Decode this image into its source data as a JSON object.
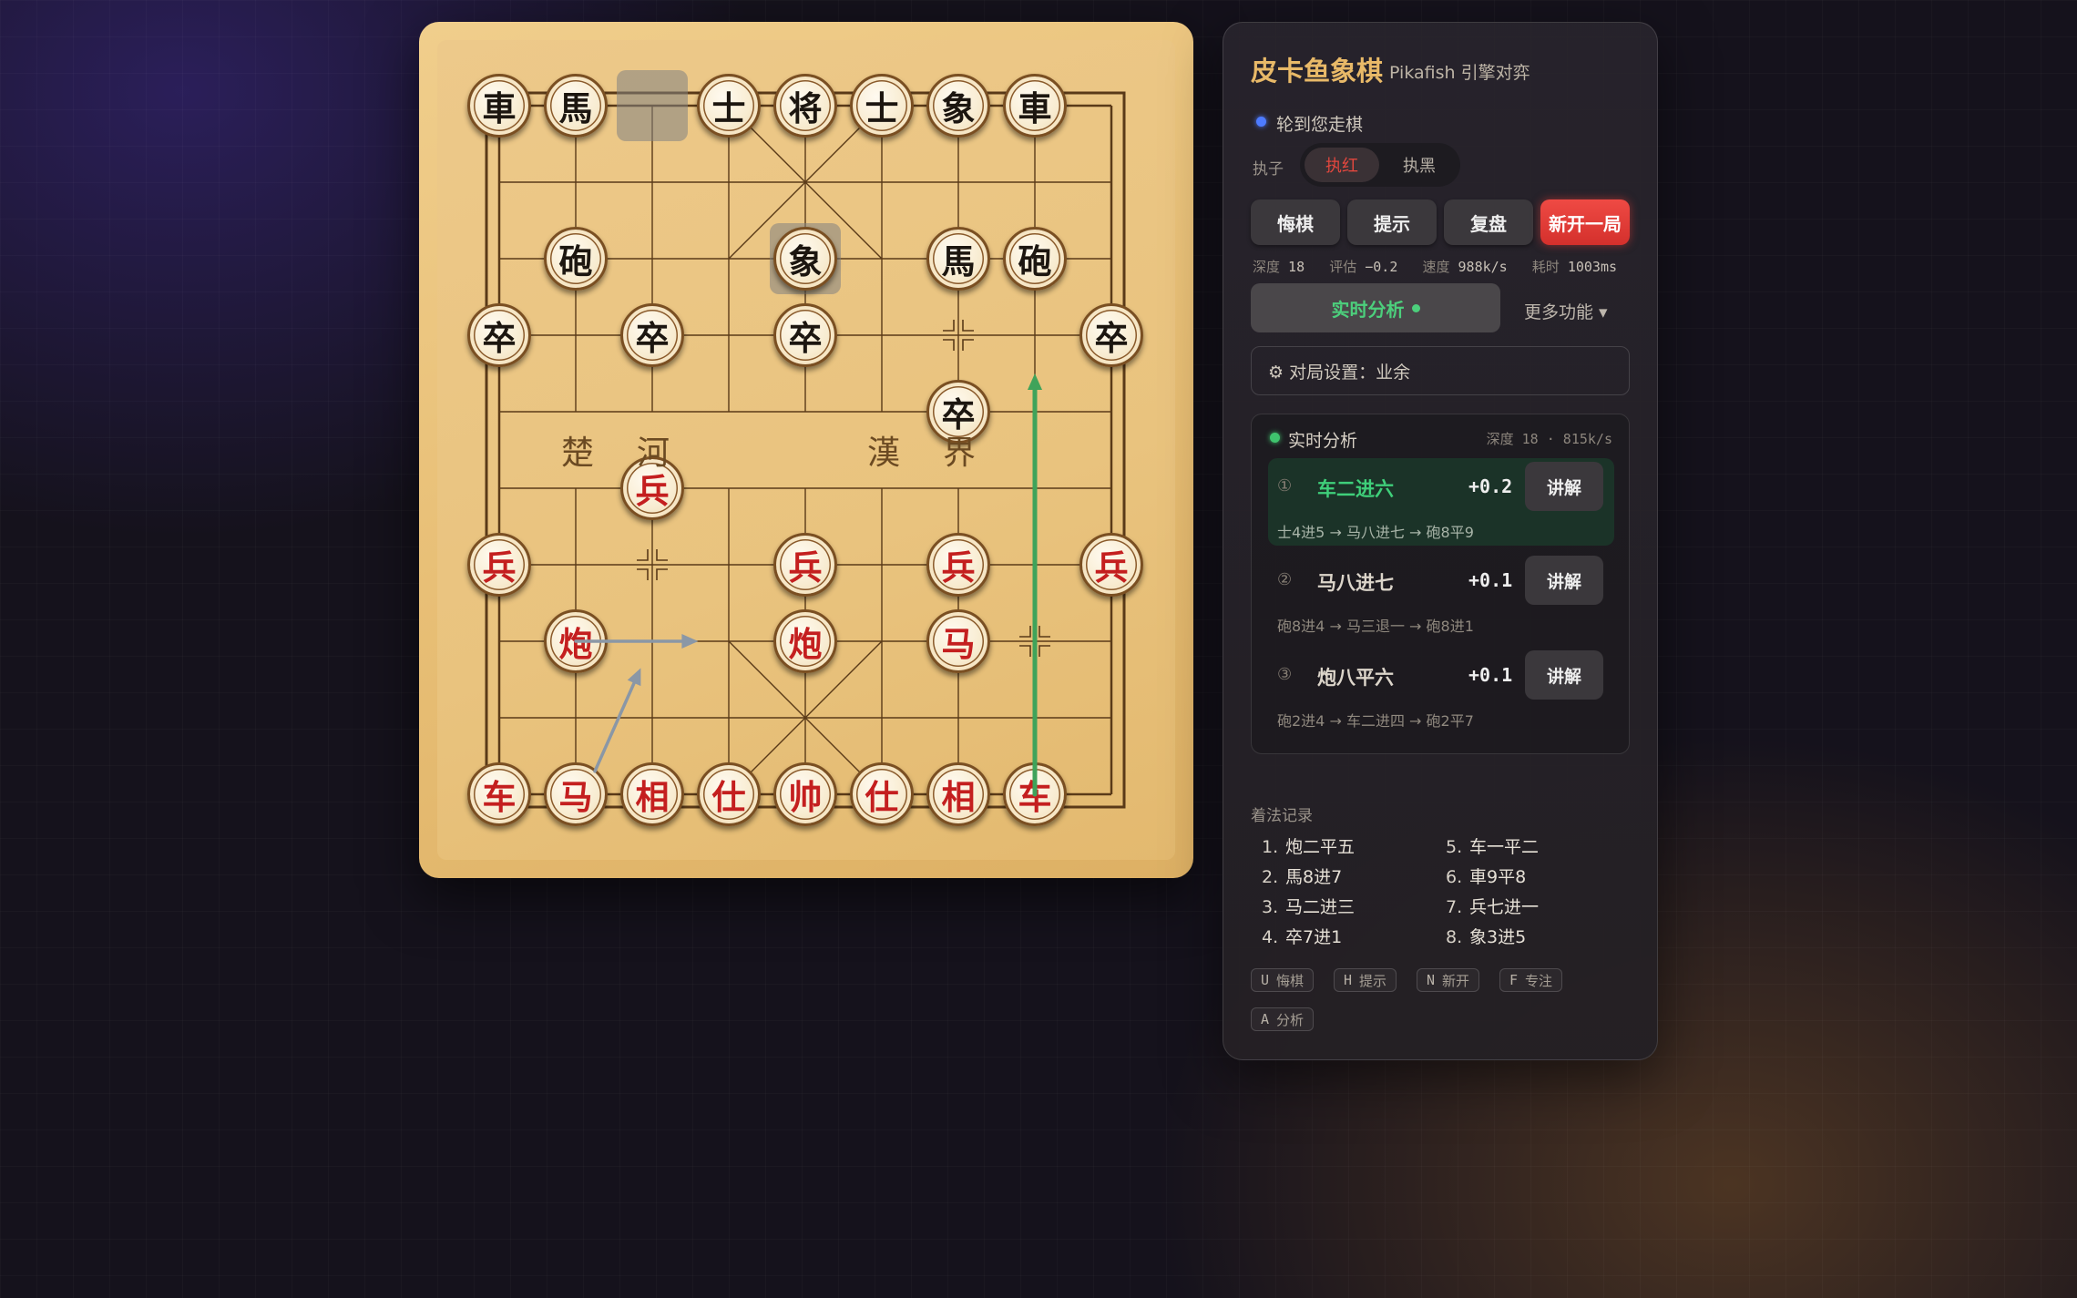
{
  "panel": {
    "title": "皮卡鱼象棋",
    "subtitle": "Pikafish 引擎对弈",
    "turn_status": "轮到您走棋",
    "side_label": "执子",
    "side_options": [
      "执红",
      "执黑"
    ],
    "side_selected": "执红",
    "buttons": {
      "undo": "悔棋",
      "hint": "提示",
      "review": "复盘",
      "new_game": "新开一局"
    },
    "stats": {
      "depth_label": "深度",
      "depth": "18",
      "eval_label": "评估",
      "eval": "−0.2",
      "speed_label": "速度",
      "speed": "988k/s",
      "time_label": "耗时",
      "time": "1003ms"
    },
    "realtime_button": "实时分析",
    "more_button": "更多功能 ▾",
    "settings": "⚙ 对局设置：业余",
    "analysis": {
      "title": "实时分析",
      "depth_info": "深度 18 · 815k/s",
      "lines": [
        {
          "num": "①",
          "move": "车二进六",
          "score": "+0.2",
          "pv": "士4进5 → 马八进七 → 砲8平9",
          "explain": "讲解"
        },
        {
          "num": "②",
          "move": "马八进七",
          "score": "+0.1",
          "pv": "砲8进4 → 马三退一 → 砲8进1",
          "explain": "讲解"
        },
        {
          "num": "③",
          "move": "炮八平六",
          "score": "+0.1",
          "pv": "砲2进4 → 车二进四 → 砲2平7",
          "explain": "讲解"
        }
      ]
    },
    "history_title": "着法记录",
    "history": [
      {
        "n": "1.",
        "move": "炮二平五"
      },
      {
        "n": "2.",
        "move": "馬8进7"
      },
      {
        "n": "3.",
        "move": "马二进三"
      },
      {
        "n": "4.",
        "move": "卒7进1"
      },
      {
        "n": "5.",
        "move": "车一平二"
      },
      {
        "n": "6.",
        "move": "車9平8"
      },
      {
        "n": "7.",
        "move": "兵七进一"
      },
      {
        "n": "8.",
        "move": "象3进5"
      }
    ],
    "shortcuts": [
      {
        "key": "U",
        "label": "悔棋"
      },
      {
        "key": "H",
        "label": "提示"
      },
      {
        "key": "N",
        "label": "新开"
      },
      {
        "key": "F",
        "label": "专注"
      },
      {
        "key": "A",
        "label": "分析"
      }
    ]
  },
  "board": {
    "river_left": [
      "楚",
      "河"
    ],
    "river_right": [
      "漢",
      "界"
    ],
    "pieces": [
      {
        "char": "車",
        "side": "black",
        "file": 0,
        "rank": 0
      },
      {
        "char": "馬",
        "side": "black",
        "file": 1,
        "rank": 0
      },
      {
        "char": "士",
        "side": "black",
        "file": 3,
        "rank": 0
      },
      {
        "char": "将",
        "side": "black",
        "file": 4,
        "rank": 0
      },
      {
        "char": "士",
        "side": "black",
        "file": 5,
        "rank": 0
      },
      {
        "char": "象",
        "side": "black",
        "file": 6,
        "rank": 0
      },
      {
        "char": "車",
        "side": "black",
        "file": 7,
        "rank": 0
      },
      {
        "char": "砲",
        "side": "black",
        "file": 1,
        "rank": 2
      },
      {
        "char": "象",
        "side": "black",
        "file": 4,
        "rank": 2
      },
      {
        "char": "馬",
        "side": "black",
        "file": 6,
        "rank": 2
      },
      {
        "char": "砲",
        "side": "black",
        "file": 7,
        "rank": 2
      },
      {
        "char": "卒",
        "side": "black",
        "file": 0,
        "rank": 3
      },
      {
        "char": "卒",
        "side": "black",
        "file": 2,
        "rank": 3
      },
      {
        "char": "卒",
        "side": "black",
        "file": 4,
        "rank": 3
      },
      {
        "char": "卒",
        "side": "black",
        "file": 8,
        "rank": 3
      },
      {
        "char": "卒",
        "side": "black",
        "file": 6,
        "rank": 4
      },
      {
        "char": "兵",
        "side": "red",
        "file": 2,
        "rank": 5
      },
      {
        "char": "兵",
        "side": "red",
        "file": 0,
        "rank": 6
      },
      {
        "char": "兵",
        "side": "red",
        "file": 4,
        "rank": 6
      },
      {
        "char": "兵",
        "side": "red",
        "file": 6,
        "rank": 6
      },
      {
        "char": "兵",
        "side": "red",
        "file": 8,
        "rank": 6
      },
      {
        "char": "炮",
        "side": "red",
        "file": 1,
        "rank": 7
      },
      {
        "char": "炮",
        "side": "red",
        "file": 4,
        "rank": 7
      },
      {
        "char": "马",
        "side": "red",
        "file": 6,
        "rank": 7
      },
      {
        "char": "车",
        "side": "red",
        "file": 0,
        "rank": 9
      },
      {
        "char": "马",
        "side": "red",
        "file": 1,
        "rank": 9
      },
      {
        "char": "相",
        "side": "red",
        "file": 2,
        "rank": 9
      },
      {
        "char": "仕",
        "side": "red",
        "file": 3,
        "rank": 9
      },
      {
        "char": "帅",
        "side": "red",
        "file": 4,
        "rank": 9
      },
      {
        "char": "仕",
        "side": "red",
        "file": 5,
        "rank": 9
      },
      {
        "char": "相",
        "side": "red",
        "file": 6,
        "rank": 9
      },
      {
        "char": "车",
        "side": "red",
        "file": 7,
        "rank": 9
      }
    ],
    "last_move_highlights": [
      {
        "file": 2,
        "rank": 0
      },
      {
        "file": 4,
        "rank": 2
      }
    ],
    "arrows": [
      {
        "from": {
          "file": 7,
          "rank": 9
        },
        "to": {
          "file": 7,
          "rank": 3.5
        },
        "color": "#3fa35a"
      },
      {
        "from": {
          "file": 1,
          "rank": 7
        },
        "to": {
          "file": 2.6,
          "rank": 7
        },
        "color": "#8a97a6"
      },
      {
        "from": {
          "file": 1.25,
          "rank": 8.7
        },
        "to": {
          "file": 1.85,
          "rank": 7.35
        },
        "color": "#8a97a6"
      }
    ],
    "colors": {
      "red": "#c41f1f",
      "black": "#1c1610",
      "line": "#5a3a18"
    }
  }
}
